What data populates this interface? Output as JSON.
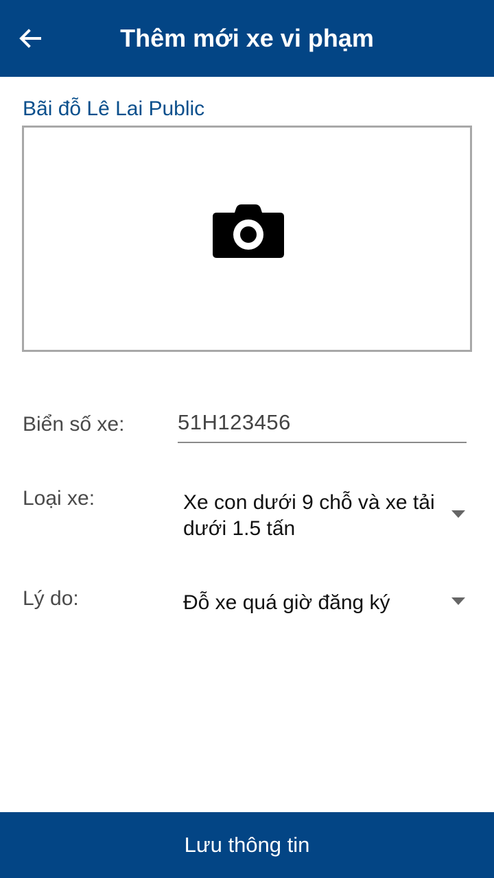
{
  "header": {
    "title": "Thêm mới xe vi phạm",
    "back_icon": "arrow-left-icon",
    "background": "#034585"
  },
  "parking_lot": {
    "name": "Bãi đỗ Lê Lai Public"
  },
  "photo": {
    "icon": "camera-icon"
  },
  "form": {
    "plate": {
      "label": "Biển số xe:",
      "value": "51H123456"
    },
    "vehicle_type": {
      "label": "Loại xe:",
      "value": "Xe con dưới 9 chỗ và xe tải dưới 1.5 tấn",
      "icon": "dropdown-caret-icon"
    },
    "reason": {
      "label": "Lý do:",
      "value": "Đỗ xe quá giờ đăng ký",
      "icon": "dropdown-caret-icon"
    }
  },
  "footer": {
    "save_label": "Lưu thông tin",
    "background": "#034585"
  }
}
